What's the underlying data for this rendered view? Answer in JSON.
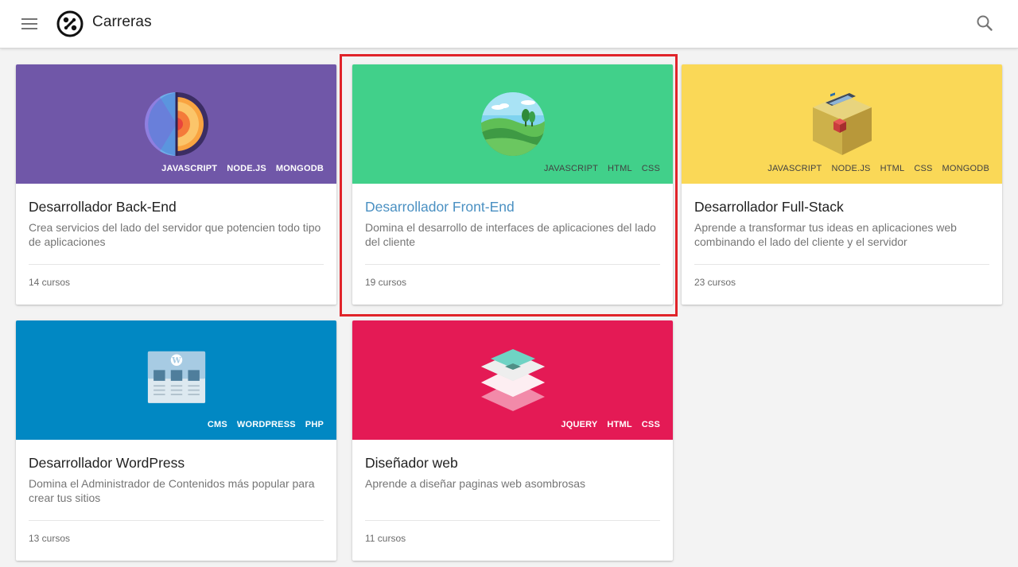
{
  "app": {
    "title": "Carreras",
    "menu_icon": "menu-icon",
    "logo_icon": "logo-icon",
    "search_icon": "search-icon"
  },
  "colors": {
    "backend": "#7057a8",
    "frontend": "#41d08a",
    "fullstack": "#fad857",
    "wordpress": "#0188c3",
    "design": "#e41a55",
    "highlight": "#e0242a"
  },
  "cards": [
    {
      "title": "Desarrollador Back-End",
      "description": "Crea servicios del lado del servidor que potencien todo tipo de aplicaciones",
      "count": "14 cursos",
      "tags": [
        "JAVASCRIPT",
        "NODE.JS",
        "MONGODB"
      ],
      "illustration": "earth-core-icon"
    },
    {
      "title": "Desarrollador Front-End",
      "description": "Domina el desarrollo de interfaces de aplicaciones del lado del cliente",
      "count": "19 cursos",
      "tags": [
        "JAVASCRIPT",
        "HTML",
        "CSS"
      ],
      "illustration": "landscape-icon"
    },
    {
      "title": "Desarrollador Full-Stack",
      "description": "Aprende a transformar tus ideas en aplicaciones web combinando el lado del cliente y el servidor",
      "count": "23 cursos",
      "tags": [
        "JAVASCRIPT",
        "NODE.JS",
        "HTML",
        "CSS",
        "MONGODB"
      ],
      "illustration": "box-icon"
    },
    {
      "title": "Desarrollador WordPress",
      "description": "Domina el Administrador de Contenidos más popular para crear tus sitios",
      "count": "13 cursos",
      "tags": [
        "CMS",
        "WORDPRESS",
        "PHP"
      ],
      "illustration": "wordpress-page-icon"
    },
    {
      "title": "Diseñador web",
      "description": "Aprende a diseñar paginas web asombrosas",
      "count": "11 cursos",
      "tags": [
        "JQUERY",
        "HTML",
        "CSS"
      ],
      "illustration": "layers-icon"
    }
  ]
}
